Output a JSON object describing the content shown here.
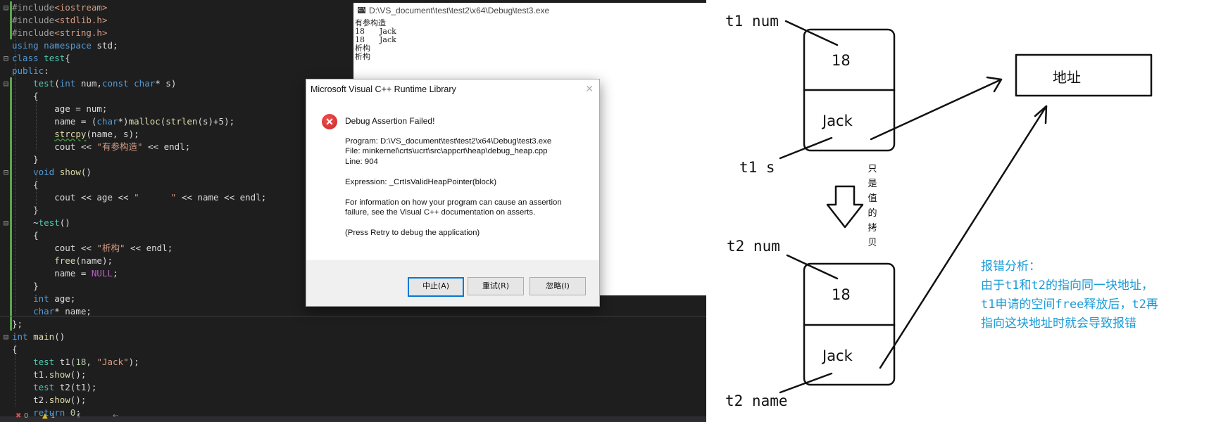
{
  "editor": {
    "lines": [
      {
        "segments": [
          {
            "t": "#include",
            "c": "pp"
          },
          {
            "t": "<iostream>",
            "c": "inc"
          }
        ]
      },
      {
        "segments": [
          {
            "t": "#include",
            "c": "pp"
          },
          {
            "t": "<stdlib.h>",
            "c": "inc"
          }
        ]
      },
      {
        "segments": [
          {
            "t": "#include",
            "c": "pp"
          },
          {
            "t": "<string.h>",
            "c": "inc"
          }
        ]
      },
      {
        "segments": [
          {
            "t": "using",
            "c": "kw"
          },
          {
            "t": " "
          },
          {
            "t": "namespace",
            "c": "kw"
          },
          {
            "t": " std;"
          }
        ]
      },
      {
        "segments": [
          {
            "t": "class",
            "c": "kw"
          },
          {
            "t": " "
          },
          {
            "t": "test",
            "c": "ty"
          },
          {
            "t": "{"
          }
        ]
      },
      {
        "segments": [
          {
            "t": "public",
            "c": "kw"
          },
          {
            "t": ":"
          }
        ]
      },
      {
        "segments": [
          {
            "t": "    "
          },
          {
            "t": "test",
            "c": "ty"
          },
          {
            "t": "("
          },
          {
            "t": "int",
            "c": "kw"
          },
          {
            "t": " num,"
          },
          {
            "t": "const",
            "c": "kw"
          },
          {
            "t": " "
          },
          {
            "t": "char",
            "c": "kw"
          },
          {
            "t": "* s)"
          }
        ]
      },
      {
        "segments": [
          {
            "t": "    {"
          }
        ]
      },
      {
        "segments": [
          {
            "t": "        age = num;"
          }
        ]
      },
      {
        "segments": [
          {
            "t": "        name = ("
          },
          {
            "t": "char",
            "c": "kw"
          },
          {
            "t": "*)"
          },
          {
            "t": "malloc",
            "c": "fn"
          },
          {
            "t": "("
          },
          {
            "t": "strlen",
            "c": "fn"
          },
          {
            "t": "(s)+5);"
          }
        ]
      },
      {
        "segments": [
          {
            "t": "        "
          },
          {
            "t": "strcpy",
            "c": "fn",
            "sq": true
          },
          {
            "t": "(name, s);"
          }
        ]
      },
      {
        "segments": [
          {
            "t": "        cout << "
          },
          {
            "t": "\"有参构造\"",
            "c": "st"
          },
          {
            "t": " << endl;"
          }
        ]
      },
      {
        "segments": [
          {
            "t": "    }"
          }
        ]
      },
      {
        "segments": [
          {
            "t": "    "
          },
          {
            "t": "void",
            "c": "kw"
          },
          {
            "t": " "
          },
          {
            "t": "show",
            "c": "fn"
          },
          {
            "t": "()"
          }
        ]
      },
      {
        "segments": [
          {
            "t": "    {"
          }
        ]
      },
      {
        "segments": [
          {
            "t": "        cout << age << "
          },
          {
            "t": "\"      \"",
            "c": "st"
          },
          {
            "t": " << name << endl;"
          }
        ]
      },
      {
        "segments": [
          {
            "t": "    }"
          }
        ]
      },
      {
        "segments": [
          {
            "t": "    ~"
          },
          {
            "t": "test",
            "c": "ty"
          },
          {
            "t": "()"
          }
        ]
      },
      {
        "segments": [
          {
            "t": "    {"
          }
        ]
      },
      {
        "segments": [
          {
            "t": "        cout << "
          },
          {
            "t": "\"析构\"",
            "c": "st"
          },
          {
            "t": " << endl;"
          }
        ]
      },
      {
        "segments": [
          {
            "t": "        "
          },
          {
            "t": "free",
            "c": "fn"
          },
          {
            "t": "(name);"
          }
        ]
      },
      {
        "segments": [
          {
            "t": "        name = "
          },
          {
            "t": "NULL",
            "c": "ma"
          },
          {
            "t": ";"
          }
        ]
      },
      {
        "segments": [
          {
            "t": "    }"
          }
        ]
      },
      {
        "segments": [
          {
            "t": "    "
          },
          {
            "t": "int",
            "c": "kw"
          },
          {
            "t": " age;"
          }
        ]
      },
      {
        "segments": [
          {
            "t": "    "
          },
          {
            "t": "char",
            "c": "kw"
          },
          {
            "t": "* name;"
          }
        ]
      },
      {
        "segments": [
          {
            "t": "};"
          }
        ]
      },
      {
        "segments": [
          {
            "t": "int",
            "c": "kw"
          },
          {
            "t": " "
          },
          {
            "t": "main",
            "c": "fn"
          },
          {
            "t": "()"
          }
        ]
      },
      {
        "segments": [
          {
            "t": "{"
          }
        ]
      },
      {
        "segments": [
          {
            "t": "    "
          },
          {
            "t": "test",
            "c": "ty"
          },
          {
            "t": " t1("
          },
          {
            "t": "18",
            "c": "nm"
          },
          {
            "t": ", "
          },
          {
            "t": "\"Jack\"",
            "c": "st"
          },
          {
            "t": ");"
          }
        ]
      },
      {
        "segments": [
          {
            "t": "    t1."
          },
          {
            "t": "show",
            "c": "fn"
          },
          {
            "t": "();"
          }
        ]
      },
      {
        "segments": [
          {
            "t": "    "
          },
          {
            "t": "test",
            "c": "ty"
          },
          {
            "t": " t2(t1);"
          }
        ]
      },
      {
        "segments": [
          {
            "t": "    t2."
          },
          {
            "t": "show",
            "c": "fn"
          },
          {
            "t": "();"
          }
        ]
      },
      {
        "segments": [
          {
            "t": "    "
          },
          {
            "t": "return",
            "c": "kw"
          },
          {
            "t": " "
          },
          {
            "t": "0",
            "c": "nm"
          },
          {
            "t": ";"
          }
        ]
      }
    ],
    "status": {
      "errors": "0",
      "warnings": "1"
    }
  },
  "console": {
    "title": "D:\\VS_document\\test\\test2\\x64\\Debug\\test3.exe",
    "icon": "C:\\",
    "lines": [
      "有参构造",
      "18      Jack",
      "18      Jack",
      "析构",
      "析构"
    ]
  },
  "dialog": {
    "title": "Microsoft Visual C++ Runtime Library",
    "close": "✕",
    "heading": "Debug Assertion Failed!",
    "program": "Program: D:\\VS_document\\test\\test2\\x64\\Debug\\test3.exe",
    "file": "File: minkernel\\crts\\ucrt\\src\\appcrt\\heap\\debug_heap.cpp",
    "line": "Line: 904",
    "expression": "Expression: _CrtIsValidHeapPointer(block)",
    "info1": "For information on how your program can cause an assertion",
    "info2": "failure, see the Visual C++ documentation on asserts.",
    "retry_hint": "(Press Retry to debug the application)",
    "buttons": {
      "abort": "中止(A)",
      "retry": "重试(R)",
      "ignore": "忽略(I)"
    }
  },
  "diagram": {
    "t1_num": "t1 num",
    "t1_s": "t1 s",
    "t2_num": "t2 num",
    "t2_name": "t2 name",
    "val_age": "18",
    "val_name": "Jack",
    "address": "地址",
    "vertical_note": [
      "只",
      "是",
      "值",
      "的",
      "拷",
      "贝"
    ],
    "analysis": [
      "报错分析：",
      "由于t1和t2的指向同一块地址，",
      "t1申请的空间free释放后，t2再",
      "指向这块地址时就会导致报错"
    ],
    "colors": {
      "note": "#1a9bd7"
    }
  }
}
